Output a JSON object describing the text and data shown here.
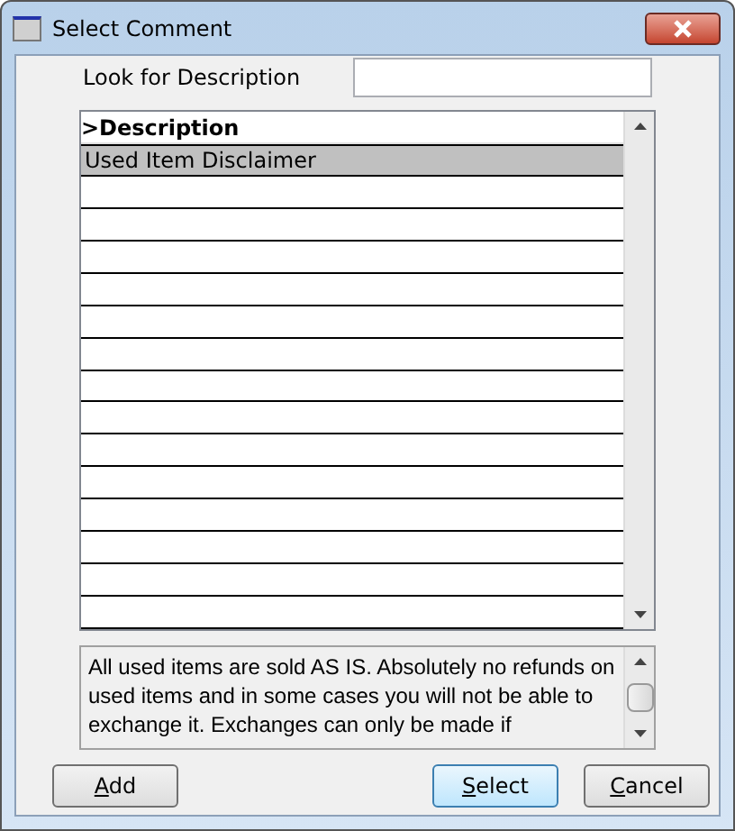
{
  "window": {
    "title": "Select Comment"
  },
  "search": {
    "label": "Look for Description"
  },
  "table": {
    "columns": [
      ">Description"
    ],
    "rows": [
      {
        "description": "Used Item Disclaimer",
        "selected": true
      }
    ]
  },
  "memo": {
    "text": "All used items are sold AS IS. Absolutely no refunds on used items and in some cases you will not be able to exchange it. Exchanges can only be made if"
  },
  "buttons": [
    {
      "underlined": "A",
      "rest": "dd",
      "default": false
    },
    {
      "underlined": "S",
      "rest": "elect",
      "default": true
    },
    {
      "underlined": "C",
      "rest": "ancel",
      "default": false
    }
  ]
}
